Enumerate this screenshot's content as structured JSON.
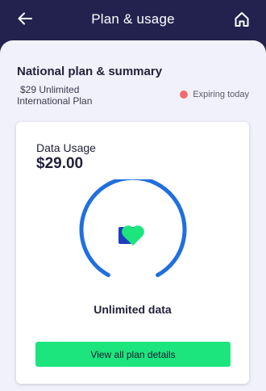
{
  "header": {
    "title": "Plan & usage",
    "back_icon": "arrow-left-icon",
    "home_icon": "home-icon",
    "background": "#23224f"
  },
  "summary": {
    "section_title": "National plan & summary",
    "plan_name_line1": "$29 Unlimited",
    "plan_name_line2": "International Plan",
    "status_text": "Expiring today",
    "status_color": "#f26d6d"
  },
  "usage_card": {
    "label": "Data Usage",
    "amount": "$29.00",
    "gauge_color": "#1f6fe0",
    "gauge_icon": "heart-logo-icon",
    "usage_label": "Unlimited data",
    "button_label": "View all plan details",
    "button_color": "#1de57e"
  }
}
